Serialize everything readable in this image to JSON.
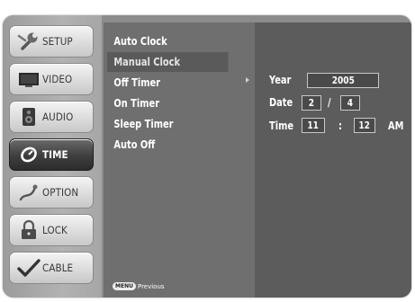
{
  "menu": {
    "items": [
      {
        "label": "SETUP",
        "icon": "wrench-icon",
        "active": false
      },
      {
        "label": "VIDEO",
        "icon": "monitor-icon",
        "active": false
      },
      {
        "label": "AUDIO",
        "icon": "speaker-icon",
        "active": false
      },
      {
        "label": "TIME",
        "icon": "clock-icon",
        "active": true
      },
      {
        "label": "OPTION",
        "icon": "option-icon",
        "active": false
      },
      {
        "label": "LOCK",
        "icon": "padlock-icon",
        "active": false
      },
      {
        "label": "CABLE",
        "icon": "cable-check-icon",
        "active": false
      }
    ]
  },
  "submenu": {
    "items": [
      {
        "label": "Auto Clock"
      },
      {
        "label": "Manual Clock"
      },
      {
        "label": "Off Timer"
      },
      {
        "label": "On Timer"
      },
      {
        "label": "Sleep Timer"
      },
      {
        "label": "Auto Off"
      }
    ],
    "selected_index": 1,
    "footer": {
      "key": "MENU",
      "label": "Previous"
    }
  },
  "clock_panel": {
    "year_label": "Year",
    "year_value": "2005",
    "date_label": "Date",
    "date_month": "2",
    "date_separator": "/",
    "date_day": "4",
    "time_label": "Time",
    "time_hour": "11",
    "time_separator": ":",
    "time_minute": "12",
    "time_ampm": "AM"
  },
  "colors": {
    "active_tab": "#333333",
    "submenu_bg": "#6f6f6f",
    "panel_bg": "#5c5c5c"
  }
}
